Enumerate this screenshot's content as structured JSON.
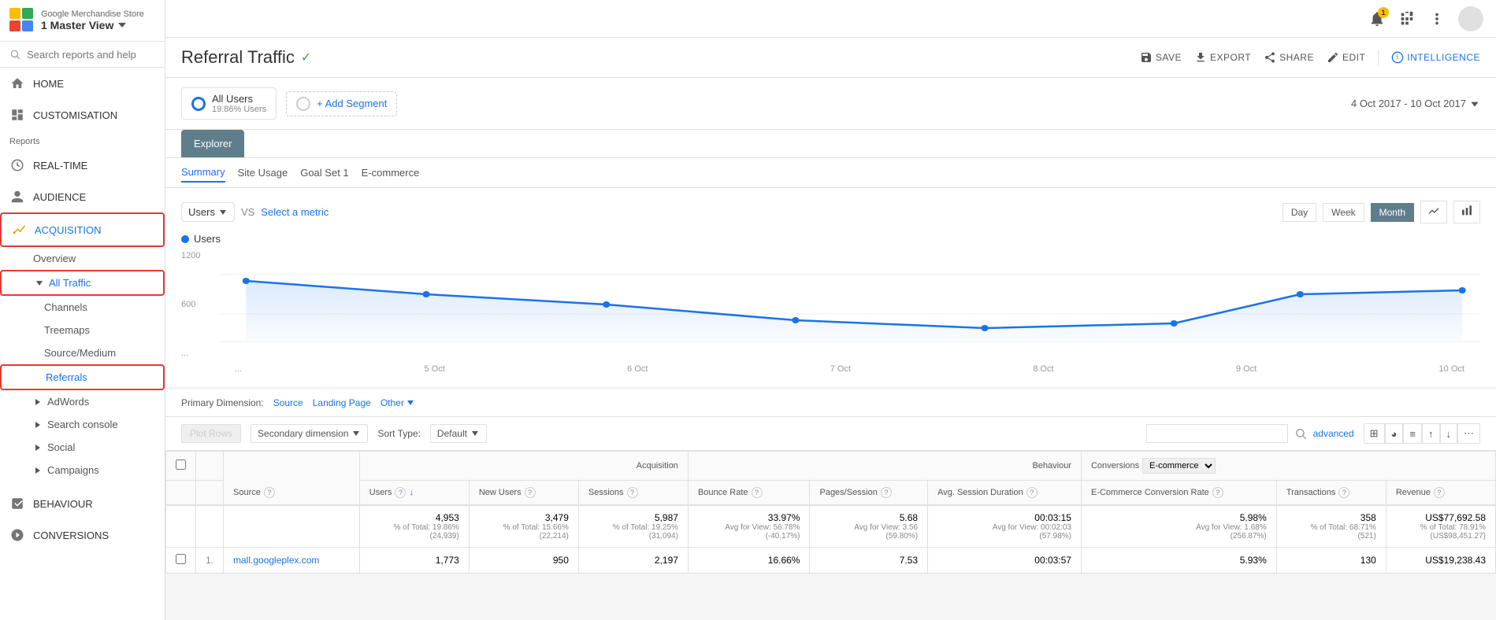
{
  "app": {
    "store_name": "Google Merchandise Store",
    "view_name": "1 Master View"
  },
  "sidebar": {
    "search_placeholder": "Search reports and help",
    "nav_items": [
      {
        "id": "home",
        "label": "HOME",
        "icon": "home"
      },
      {
        "id": "customisation",
        "label": "CUSTOMISATION",
        "icon": "dashboard"
      },
      {
        "id": "reports_label",
        "label": "Reports",
        "type": "section"
      },
      {
        "id": "realtime",
        "label": "REAL-TIME",
        "icon": "clock"
      },
      {
        "id": "audience",
        "label": "AUDIENCE",
        "icon": "person"
      },
      {
        "id": "acquisition",
        "label": "ACQUISITION",
        "icon": "acquisition",
        "active": true,
        "highlighted": true
      }
    ],
    "acquisition_sub": [
      {
        "id": "overview",
        "label": "Overview"
      },
      {
        "id": "all-traffic",
        "label": "All Traffic",
        "expanded": true,
        "highlighted": true
      },
      {
        "id": "channels",
        "label": "Channels"
      },
      {
        "id": "treemaps",
        "label": "Treemaps"
      },
      {
        "id": "source-medium",
        "label": "Source/Medium"
      },
      {
        "id": "referrals",
        "label": "Referrals",
        "active": true,
        "highlighted": true
      }
    ],
    "more_items": [
      {
        "id": "adwords",
        "label": "AdWords",
        "expandable": true
      },
      {
        "id": "search-console",
        "label": "Search console",
        "expandable": true
      },
      {
        "id": "social",
        "label": "Social",
        "expandable": true
      },
      {
        "id": "campaigns",
        "label": "Campaigns",
        "expandable": true
      }
    ],
    "bottom_items": [
      {
        "id": "behaviour",
        "label": "BEHAVIOUR",
        "icon": "behaviour"
      },
      {
        "id": "conversions",
        "label": "CONVERSIONS",
        "icon": "conversions"
      }
    ]
  },
  "report": {
    "title": "Referral Traffic",
    "verified": true,
    "actions": [
      {
        "id": "save",
        "label": "SAVE",
        "icon": "save"
      },
      {
        "id": "export",
        "label": "EXPORT",
        "icon": "export"
      },
      {
        "id": "share",
        "label": "SHARE",
        "icon": "share"
      },
      {
        "id": "edit",
        "label": "EDIT",
        "icon": "edit"
      },
      {
        "id": "intelligence",
        "label": "INTELLIGENCE",
        "icon": "intelligence"
      }
    ],
    "date_range": "4 Oct 2017 - 10 Oct 2017"
  },
  "segment": {
    "name": "All Users",
    "percentage": "19.86% Users",
    "add_label": "+ Add Segment"
  },
  "tabs": {
    "main": "Explorer",
    "sub": [
      "Summary",
      "Site Usage",
      "Goal Set 1",
      "E-commerce"
    ],
    "active_sub": "Summary"
  },
  "chart": {
    "metric": "Users",
    "vs_label": "VS",
    "select_metric": "Select a metric",
    "time_buttons": [
      "Day",
      "Week",
      "Month"
    ],
    "active_time": "Month",
    "legend": "Users",
    "y_labels": [
      "1200",
      "600",
      "..."
    ],
    "x_labels": [
      "...",
      "5 Oct",
      "6 Oct",
      "7 Oct",
      "8 Oct",
      "9 Oct",
      "10 Oct"
    ]
  },
  "primary_dimension": {
    "label": "Primary Dimension:",
    "options": [
      "Source",
      "Landing Page",
      "Other"
    ]
  },
  "table": {
    "plot_rows_label": "Plot Rows",
    "secondary_dimension_label": "Secondary dimension",
    "sort_type_label": "Sort Type:",
    "sort_default": "Default",
    "search_placeholder": "",
    "advanced_label": "advanced",
    "view_options": [
      "grid",
      "pie",
      "list",
      "sort-asc",
      "sort-desc",
      "scatter"
    ],
    "columns": {
      "checkbox": "",
      "number": "",
      "source": "Source",
      "acquisition_group": "Acquisition",
      "behaviour_group": "Behaviour",
      "conversions_group": "Conversions",
      "users": "Users",
      "new_users": "New Users",
      "sessions": "Sessions",
      "bounce_rate": "Bounce Rate",
      "pages_session": "Pages/Session",
      "avg_session": "Avg. Session Duration",
      "ecommerce_rate": "E-Commerce Conversion Rate",
      "transactions": "Transactions",
      "revenue": "Revenue"
    },
    "totals": {
      "users": "4,953",
      "users_pct": "% of Total: 19.86%",
      "users_total": "(24,939)",
      "new_users": "3,479",
      "new_users_pct": "% of Total: 15.66%",
      "new_users_total": "(22,214)",
      "sessions": "5,987",
      "sessions_pct": "% of Total: 19.25%",
      "sessions_total": "(31,094)",
      "bounce_rate": "33.97%",
      "bounce_avg": "Avg for View: 56.78%",
      "bounce_delta": "(-40.17%)",
      "pages_session": "5.68",
      "pages_avg": "Avg for View: 3.56",
      "pages_delta": "(59.80%)",
      "avg_session": "00:03:15",
      "avg_session_avg": "Avg for View: 00:02:03",
      "avg_session_delta": "(57.98%)",
      "ecommerce_rate": "5.98%",
      "ecommerce_avg": "Avg for View: 1.68%",
      "ecommerce_delta": "(256.87%)",
      "transactions": "358",
      "transactions_pct": "% of Total: 68.71%",
      "transactions_total": "(521)",
      "revenue": "US$77,692.58",
      "revenue_pct": "% of Total: 78.91%",
      "revenue_total": "(US$98,451.27)"
    },
    "rows": [
      {
        "num": "1.",
        "source": "mall.googleplex.com",
        "users": "1,773",
        "new_users": "950",
        "sessions": "2,197",
        "bounce_rate": "16.66%",
        "pages_session": "7.53",
        "avg_session": "00:03:57",
        "ecommerce_rate": "5.93%",
        "transactions": "130",
        "revenue": "US$19,238.43"
      }
    ]
  },
  "conversions_dropdown": "E-commerce"
}
